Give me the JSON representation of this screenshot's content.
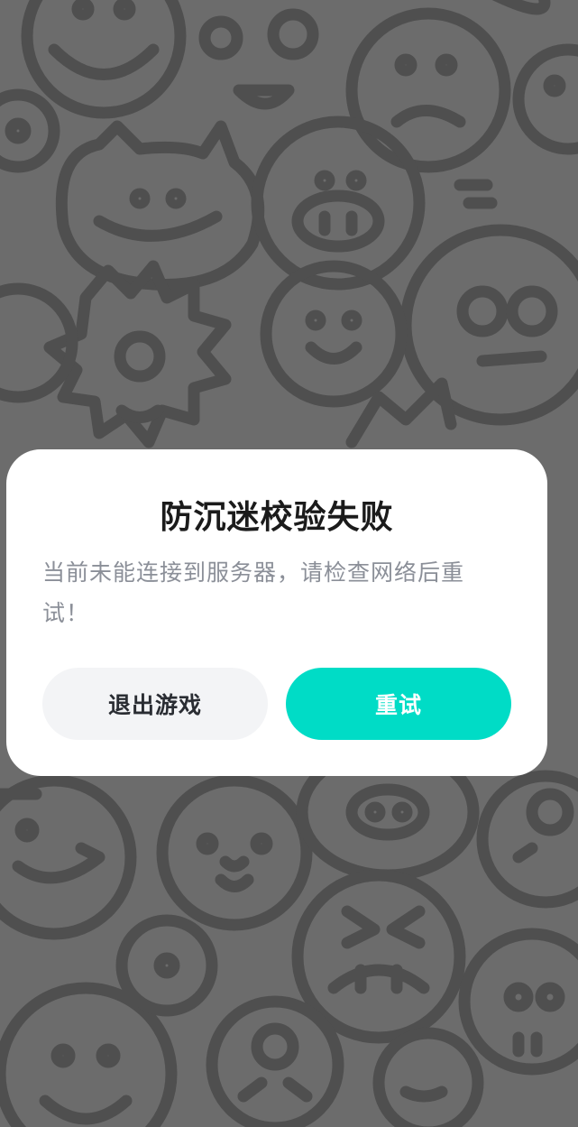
{
  "background": {
    "pattern": "doodle-monster-faces",
    "color": "#6c6c6c",
    "line_color": "#4f4f4f"
  },
  "dialog": {
    "title": "防沉迷校验失败",
    "message": "当前未能连接到服务器，请检查网络后重试！",
    "buttons": {
      "exit_label": "退出游戏",
      "retry_label": "重试"
    },
    "colors": {
      "accent": "#00dcc6",
      "secondary_button": "#f3f4f6",
      "title": "#1b1b1b",
      "message": "#8b8f98"
    }
  }
}
